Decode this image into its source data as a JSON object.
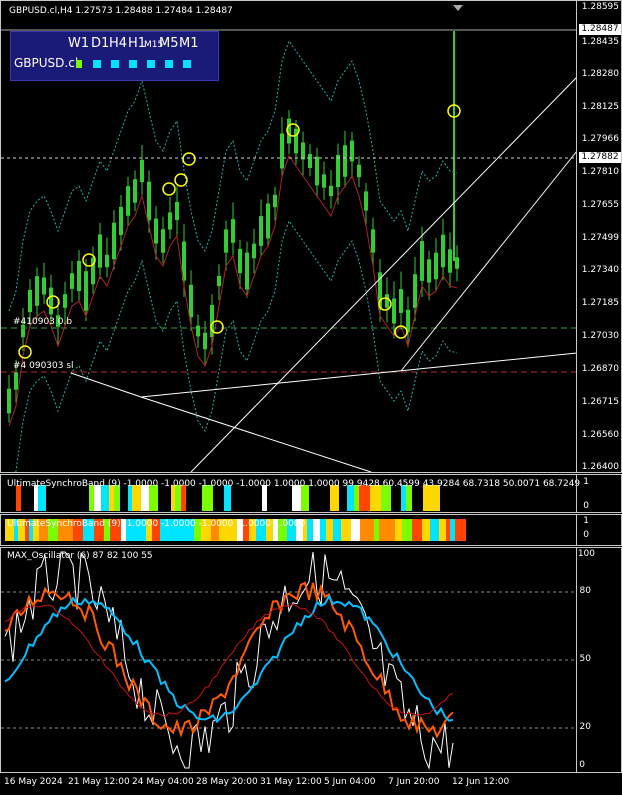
{
  "header": {
    "symbol_info": "GBPUSD.cl,H4  1.27573 1.28488 1.27484 1.28487"
  },
  "tf_panel": {
    "timeframes": [
      "W1",
      "D1",
      "H4",
      "H1",
      "M15",
      "M5",
      "M1"
    ],
    "symbol": "GBPUSD.cl",
    "status_colors": [
      "#00e5ff",
      "#00e5ff",
      "#00e5ff",
      "#00e5ff",
      "#00e5ff",
      "#00e5ff"
    ],
    "symbol_marker_color": "#7cfc00"
  },
  "price_axis": {
    "ticks": [
      "1.28595",
      "1.28435",
      "1.28280",
      "1.28125",
      "1.27966",
      "1.27810",
      "1.27655",
      "1.27499",
      "1.27340",
      "1.27185",
      "1.27030",
      "1.26870",
      "1.26715",
      "1.26560",
      "1.26400"
    ],
    "current_price": "1.28487",
    "tag_price": "1.27882"
  },
  "levels": {
    "buy_label": "#410903 0.b",
    "sl_label": "#4 090303 sl"
  },
  "ind1": {
    "label": "UltimateSynchroBand (9) -1.0000 -1.0000 -1.0000 -1.0000 1.0000 1.0000 99.9428 60.4599 43.9284 68.7318 50.0071 68.7249",
    "scale_top": "1",
    "scale_bot": "0"
  },
  "ind2": {
    "label": "UltimateSynchroBand (9) -1.0000 -1.0000 -1.0000 -1.0000 1.0000",
    "scale_top": "1",
    "scale_bot": "0"
  },
  "ind3": {
    "label": "MAX_Oscillator (6) 87 82 100 55",
    "ticks": [
      "100",
      "80",
      "50",
      "20",
      "0"
    ]
  },
  "time_axis": [
    "16 May 2024",
    "21 May 12:00",
    "24 May 04:00",
    "28 May 20:00",
    "31 May 12:00",
    "5 Jun 04:00",
    "7 Jun 20:00",
    "12 Jun 12:00"
  ],
  "colors": {
    "candle": "#32cd32",
    "band": "#20b2aa",
    "ma": "#b22222",
    "osc_fast": "#ffffff",
    "osc_cyan": "#00bfff",
    "osc_orange": "#ff5a00",
    "osc_red": "#cc1010",
    "circle": "#ffff00"
  }
}
